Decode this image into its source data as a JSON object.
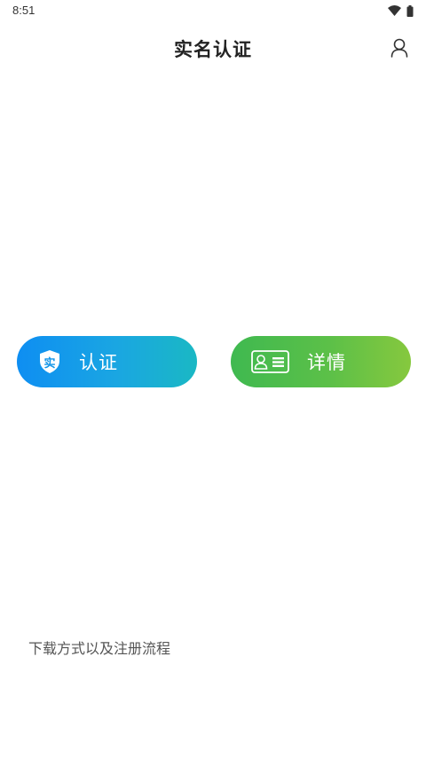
{
  "status_bar": {
    "time": "8:51",
    "icons": [
      "wifi-icon",
      "battery-icon"
    ]
  },
  "header": {
    "title": "实名认证",
    "profile_icon": "user-icon"
  },
  "actions": {
    "auth_button": {
      "label": "认证",
      "icon": "shield-icon",
      "icon_char": "实",
      "colors": [
        "#0e8ef2",
        "#1ab8c4"
      ]
    },
    "detail_button": {
      "label": "详情",
      "icon": "id-card-icon",
      "colors": [
        "#3fb950",
        "#86c83e"
      ]
    }
  },
  "footer": {
    "link_text": "下载方式以及注册流程"
  }
}
